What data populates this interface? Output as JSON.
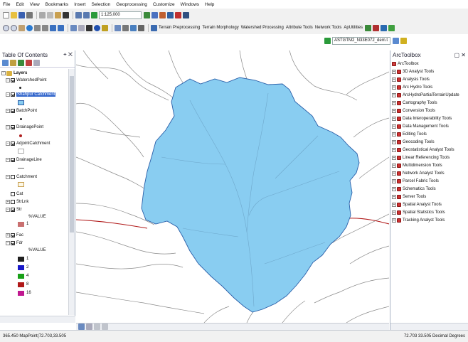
{
  "menu": [
    "File",
    "Edit",
    "View",
    "Bookmarks",
    "Insert",
    "Selection",
    "Geoprocessing",
    "Customize",
    "Windows",
    "Help"
  ],
  "toolbar": {
    "scale": "1:125,000",
    "tool_menus": [
      "Terrain Preprocessing",
      "Terrain Morphology",
      "Watershed Processing",
      "Attribute Tools",
      "Network Tools",
      "ApUtilities"
    ],
    "layer_combo": "ASTGTM2_N33E072_dem.t"
  },
  "toc": {
    "title": "Table Of Contents",
    "root": "Layers",
    "layers": [
      {
        "label": "WatershedPoint",
        "checked": true
      },
      {
        "label": "Shahpur Catchment",
        "checked": true,
        "selected": true
      },
      {
        "label": "BatchPoint",
        "checked": true
      },
      {
        "label": "DrainagePoint",
        "checked": true
      },
      {
        "label": "AdjointCatchment",
        "checked": true
      },
      {
        "label": "DrainageLine",
        "checked": true
      },
      {
        "label": "Catchment",
        "checked": false
      },
      {
        "label": "Cat",
        "checked": false
      },
      {
        "label": "StrLnk",
        "checked": false
      },
      {
        "label": "Str",
        "checked": true
      },
      {
        "label": "Fac",
        "checked": true
      },
      {
        "label": "Fdr",
        "checked": true
      }
    ],
    "str_value_header": "%VALUE",
    "str_value": "1",
    "fdr_value_header": "%VALUE",
    "fdr_values": [
      "1",
      "2",
      "4",
      "8",
      "16"
    ]
  },
  "arctoolbox": {
    "title": "ArcToolbox",
    "root": "ArcToolbox",
    "tools": [
      "3D Analyst Tools",
      "Analysis Tools",
      "Arc Hydro Tools",
      "ArcHydroPartialTerrainUpdate",
      "Cartography Tools",
      "Conversion Tools",
      "Data Interoperability Tools",
      "Data Management Tools",
      "Editing Tools",
      "Geocoding Tools",
      "Geostatistical Analyst Tools",
      "Linear Referencing Tools",
      "Multidimension Tools",
      "Network Analyst Tools",
      "Parcel Fabric Tools",
      "Schematics Tools",
      "Server Tools",
      "Spatial Analyst Tools",
      "Spatial Statistics Tools",
      "Tracking Analyst Tools"
    ]
  },
  "status": {
    "left": "365.450 MapPoint(72.703,33.505",
    "right": "72.703 33.505 Decimal Degrees"
  },
  "colors": {
    "catchment_fill": "#89CDF1",
    "catchment_outline": "#2a5ea8",
    "drainage": "#8a8a8a",
    "str_symbol": "#c97070",
    "fdr_values": [
      "#202020",
      "#1818c8",
      "#18a018",
      "#b01818",
      "#c01890"
    ]
  }
}
